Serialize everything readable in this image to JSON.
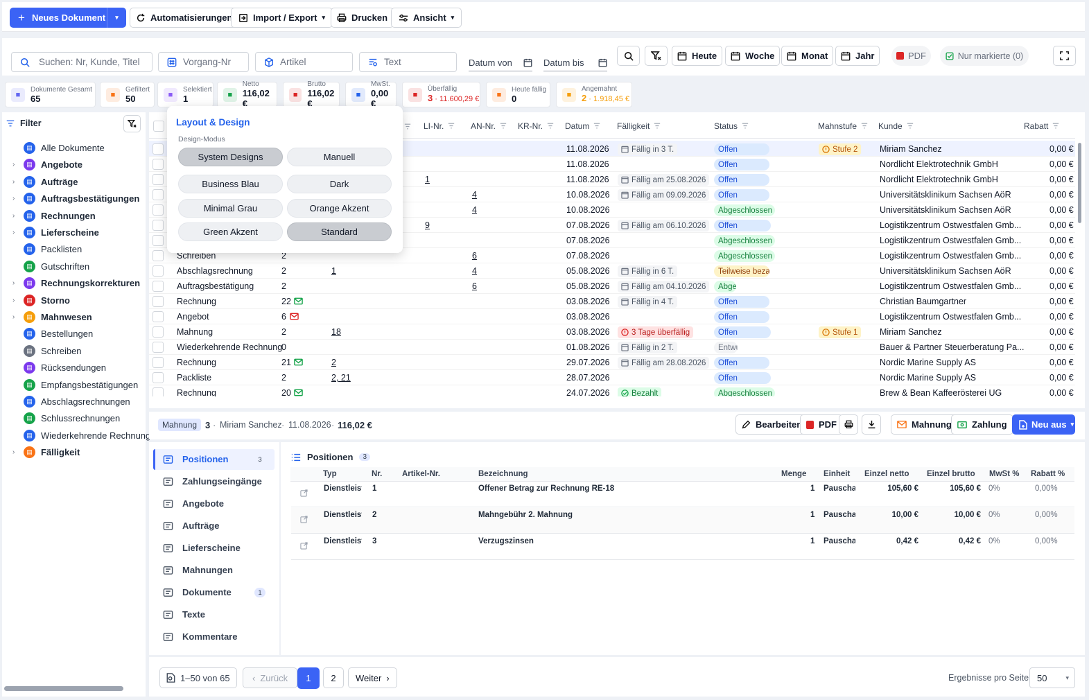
{
  "toolbar": {
    "new_doc": "Neues Dokument",
    "automations": "Automatisierungen",
    "import_export": "Import / Export",
    "print": "Drucken",
    "view": "Ansicht"
  },
  "search": {
    "search_placeholder": "Suchen: Nr, Kunde, Titel",
    "vorgang_placeholder": "Vorgang-Nr",
    "artikel_placeholder": "Artikel",
    "text_placeholder": "Text",
    "date_from": "Datum von",
    "date_to": "Datum bis",
    "today": "Heute",
    "week": "Woche",
    "month": "Monat",
    "year": "Jahr",
    "pdf": "PDF",
    "only_marked": "Nur markierte (0)"
  },
  "stats": [
    {
      "label": "Dokumente Gesamt",
      "value": "65",
      "color": "#6366f1"
    },
    {
      "label": "Gefiltert",
      "value": "50",
      "color": "#f97316"
    },
    {
      "label": "Selektiert",
      "value": "1",
      "color": "#8b5cf6"
    },
    {
      "label": "Netto",
      "value": "116,02 €",
      "color": "#16a34a"
    },
    {
      "label": "Brutto",
      "value": "116,02 €",
      "color": "#dc2626"
    },
    {
      "label": "MwSt.",
      "value": "0,00 €",
      "color": "#2563eb"
    },
    {
      "label": "Überfällig",
      "value": "3",
      "value2": "11.600,29 €",
      "color": "#dc2626"
    },
    {
      "label": "Heute fällig",
      "value": "0",
      "color": "#f97316"
    },
    {
      "label": "Angemahnt",
      "value": "2",
      "value2": "1.918,45 €",
      "color": "#f59e0b"
    }
  ],
  "sidebar": {
    "title": "Filter",
    "items": [
      {
        "label": "Alle Dokumente",
        "bold": false,
        "arrow": false,
        "color": "#2563eb"
      },
      {
        "label": "Angebote",
        "bold": true,
        "arrow": true,
        "color": "#7c3aed"
      },
      {
        "label": "Aufträge",
        "bold": true,
        "arrow": true,
        "color": "#2563eb"
      },
      {
        "label": "Auftragsbestätigungen",
        "bold": true,
        "arrow": true,
        "color": "#2563eb"
      },
      {
        "label": "Rechnungen",
        "bold": true,
        "arrow": true,
        "color": "#2563eb"
      },
      {
        "label": "Lieferscheine",
        "bold": true,
        "arrow": true,
        "color": "#2563eb"
      },
      {
        "label": "Packlisten",
        "bold": false,
        "arrow": false,
        "color": "#2563eb"
      },
      {
        "label": "Gutschriften",
        "bold": false,
        "arrow": false,
        "color": "#16a34a"
      },
      {
        "label": "Rechnungskorrekturen",
        "bold": true,
        "arrow": true,
        "color": "#7c3aed"
      },
      {
        "label": "Storno",
        "bold": true,
        "arrow": true,
        "color": "#dc2626"
      },
      {
        "label": "Mahnwesen",
        "bold": true,
        "arrow": true,
        "color": "#f59e0b"
      },
      {
        "label": "Bestellungen",
        "bold": false,
        "arrow": false,
        "color": "#2563eb"
      },
      {
        "label": "Schreiben",
        "bold": false,
        "arrow": false,
        "color": "#6b7280"
      },
      {
        "label": "Rücksendungen",
        "bold": false,
        "arrow": false,
        "color": "#7c3aed"
      },
      {
        "label": "Empfangsbestätigungen",
        "bold": false,
        "arrow": false,
        "color": "#16a34a"
      },
      {
        "label": "Abschlagsrechnungen",
        "bold": false,
        "arrow": false,
        "color": "#2563eb"
      },
      {
        "label": "Schlussrechnungen",
        "bold": false,
        "arrow": false,
        "color": "#16a34a"
      },
      {
        "label": "Wiederkehrende Rechnungen",
        "bold": false,
        "arrow": false,
        "color": "#2563eb"
      },
      {
        "label": "Fälligkeit",
        "bold": true,
        "arrow": true,
        "color": "#f97316"
      }
    ]
  },
  "table": {
    "headers": {
      "li": "LI-Nr.",
      "an": "AN-Nr.",
      "kr": "KR-Nr.",
      "datum": "Datum",
      "faellig": "Fälligkeit",
      "status": "Status",
      "mahnstufe": "Mahnstufe",
      "kunde": "Kunde",
      "rabatt": "Rabatt"
    },
    "rows": [
      {
        "typ": "",
        "nr": "",
        "ref": "",
        "li": "",
        "an": "",
        "datum": "11.08.2026",
        "due": "Fällig in 3 T.",
        "due_kind": "normal",
        "status": "Offen",
        "status_kind": "blue",
        "mahn": "Stufe 2",
        "kunde": "Miriam  Sanchez",
        "rabatt": "0,00 €",
        "mail": ""
      },
      {
        "typ": "",
        "nr": "",
        "ref": "",
        "li": "",
        "an": "",
        "datum": "11.08.2026",
        "due": "",
        "due_kind": "",
        "status": "Offen",
        "status_kind": "blue",
        "mahn": "",
        "kunde": "Nordlicht Elektrotechnik GmbH",
        "rabatt": "0,00 €",
        "mail": ""
      },
      {
        "typ": "",
        "nr": "",
        "ref": "",
        "li": "1",
        "an": "",
        "datum": "11.08.2026",
        "due": "Fällig am 25.08.2026",
        "due_kind": "normal",
        "status": "Offen",
        "status_kind": "blue",
        "mahn": "",
        "kunde": "Nordlicht Elektrotechnik GmbH",
        "rabatt": "0,00 €",
        "mail": ""
      },
      {
        "typ": "",
        "nr": "",
        "ref": "",
        "li": "",
        "an": "4",
        "datum": "10.08.2026",
        "due": "Fällig am 09.09.2026",
        "due_kind": "normal",
        "status": "Offen",
        "status_kind": "blue",
        "mahn": "",
        "kunde": "Universitätsklinikum Sachsen AöR",
        "rabatt": "0,00 €",
        "mail": ""
      },
      {
        "typ": "",
        "nr": "",
        "ref": "",
        "li": "",
        "an": "4",
        "datum": "10.08.2026",
        "due": "",
        "due_kind": "",
        "status": "Abgeschlossen",
        "status_kind": "green",
        "mahn": "",
        "kunde": "Universitätsklinikum Sachsen AöR",
        "rabatt": "0,00 €",
        "mail": ""
      },
      {
        "typ": "",
        "nr": "",
        "ref": "",
        "li": "9",
        "an": "",
        "datum": "07.08.2026",
        "due": "Fällig am 06.10.2026",
        "due_kind": "normal",
        "status": "Offen",
        "status_kind": "blue",
        "mahn": "",
        "kunde": "Logistikzentrum Ostwestfalen Gmb...",
        "rabatt": "0,00 €",
        "mail": ""
      },
      {
        "typ": "",
        "nr": "",
        "ref": "",
        "li": "",
        "an": "",
        "datum": "07.08.2026",
        "due": "",
        "due_kind": "",
        "status": "Abgeschlossen",
        "status_kind": "green",
        "mahn": "",
        "kunde": "Logistikzentrum Ostwestfalen Gmb...",
        "rabatt": "0,00 €",
        "mail": ""
      },
      {
        "typ": "Schreiben",
        "nr": "2",
        "ref": "",
        "li": "",
        "an": "6",
        "datum": "07.08.2026",
        "due": "",
        "due_kind": "",
        "status": "Abgeschlossen",
        "status_kind": "green",
        "mahn": "",
        "kunde": "Logistikzentrum Ostwestfalen Gmb...",
        "rabatt": "0,00 €",
        "mail": ""
      },
      {
        "typ": "Abschlagsrechnung",
        "nr": "2",
        "ref": "1",
        "li": "",
        "an": "4",
        "datum": "05.08.2026",
        "due": "Fällig in 6 T.",
        "due_kind": "normal",
        "status": "Teilweise bezahl",
        "status_kind": "yellow",
        "mahn": "",
        "kunde": "Universitätsklinikum Sachsen AöR",
        "rabatt": "0,00 €",
        "mail": ""
      },
      {
        "typ": "Auftragsbestätigung",
        "nr": "2",
        "ref": "",
        "li": "",
        "an": "6",
        "datum": "05.08.2026",
        "due": "Fällig am 04.10.2026",
        "due_kind": "normal",
        "status": "Abges",
        "status_kind": "green",
        "mahn": "",
        "kunde": "Logistikzentrum Ostwestfalen Gmb...",
        "rabatt": "0,00 €",
        "mail": ""
      },
      {
        "typ": "Rechnung",
        "nr": "22",
        "ref": "",
        "li": "",
        "an": "",
        "datum": "03.08.2026",
        "due": "Fällig in 4 T.",
        "due_kind": "normal",
        "status": "Offen",
        "status_kind": "blue",
        "mahn": "",
        "kunde": "Christian  Baumgartner",
        "rabatt": "0,00 €",
        "mail": "green"
      },
      {
        "typ": "Angebot",
        "nr": "6",
        "ref": "",
        "li": "",
        "an": "",
        "datum": "03.08.2026",
        "due": "",
        "due_kind": "",
        "status": "Offen",
        "status_kind": "blue",
        "mahn": "",
        "kunde": "Logistikzentrum Ostwestfalen Gmb...",
        "rabatt": "0,00 €",
        "mail": "red"
      },
      {
        "typ": "Mahnung",
        "nr": "2",
        "ref": "18",
        "li": "",
        "an": "",
        "datum": "03.08.2026",
        "due": "3 Tage überfällig",
        "due_kind": "red",
        "status": "Offen",
        "status_kind": "blue",
        "mahn": "Stufe 1",
        "kunde": "Miriam  Sanchez",
        "rabatt": "0,00 €",
        "mail": ""
      },
      {
        "typ": "Wiederkehrende Rechnung",
        "nr": "0",
        "ref": "",
        "li": "",
        "an": "",
        "datum": "01.08.2026",
        "due": "Fällig in 2 T.",
        "due_kind": "normal",
        "status": "Entwu",
        "status_kind": "gray",
        "mahn": "",
        "kunde": "Bauer & Partner Steuerberatung Pa...",
        "rabatt": "0,00 €",
        "mail": ""
      },
      {
        "typ": "Rechnung",
        "nr": "21",
        "ref": "2",
        "li": "",
        "an": "",
        "datum": "29.07.2026",
        "due": "Fällig am 28.08.2026",
        "due_kind": "normal",
        "status": "Offen",
        "status_kind": "blue",
        "mahn": "",
        "kunde": "Nordic Marine Supply AS",
        "rabatt": "0,00 €",
        "mail": "green"
      },
      {
        "typ": "Packliste",
        "nr": "2",
        "ref": "2, 21",
        "li": "",
        "an": "",
        "datum": "28.07.2026",
        "due": "",
        "due_kind": "",
        "status": "Offen",
        "status_kind": "blue",
        "mahn": "",
        "kunde": "Nordic Marine Supply AS",
        "rabatt": "0,00 €",
        "mail": ""
      },
      {
        "typ": "Rechnung",
        "nr": "20",
        "ref": "",
        "li": "",
        "an": "",
        "datum": "24.07.2026",
        "due": "Bezahlt",
        "due_kind": "ok",
        "status": "Abgeschlossen",
        "status_kind": "green",
        "mahn": "",
        "kunde": "Brew & Bean Kaffeerösterei UG",
        "rabatt": "0,00 €",
        "mail": "green"
      }
    ]
  },
  "popup": {
    "title": "Layout & Design",
    "subtitle": "Design-Modus",
    "options": [
      "System Designs",
      "Manuell",
      "Business Blau",
      "Dark",
      "Minimal Grau",
      "Orange Akzent",
      "Green Akzent",
      "Standard"
    ]
  },
  "detail": {
    "type_badge": "Mahnung",
    "number": "3",
    "customer": "Miriam Sanchez",
    "date": "11.08.2026",
    "amount": "116,02 €",
    "edit": "Bearbeiten",
    "pdf": "PDF",
    "mahnung": "Mahnung",
    "zahlung": "Zahlung",
    "neu_aus": "Neu aus",
    "nav": [
      {
        "label": "Positionen",
        "count": "3"
      },
      {
        "label": "Zahlungseingänge",
        "count": ""
      },
      {
        "label": "Angebote",
        "count": ""
      },
      {
        "label": "Aufträge",
        "count": ""
      },
      {
        "label": "Lieferscheine",
        "count": ""
      },
      {
        "label": "Mahnungen",
        "count": ""
      },
      {
        "label": "Dokumente",
        "count": "1"
      },
      {
        "label": "Texte",
        "count": ""
      },
      {
        "label": "Kommentare",
        "count": ""
      }
    ],
    "positions_title": "Positionen",
    "positions_count": "3",
    "pos_headers": {
      "typ": "Typ",
      "nr": "Nr.",
      "artikel": "Artikel-Nr.",
      "bez": "Bezeichnung",
      "menge": "Menge",
      "einheit": "Einheit",
      "netto": "Einzel netto",
      "brutto": "Einzel brutto",
      "mwst": "MwSt %",
      "rabatt": "Rabatt %"
    },
    "positions": [
      {
        "typ": "Dienstleist",
        "nr": "1",
        "bez": "Offener Betrag zur Rechnung RE-18",
        "menge": "1",
        "einheit": "Pauschal",
        "netto": "105,60 €",
        "brutto": "105,60 €",
        "mwst": "0%",
        "rabatt": "0,00%"
      },
      {
        "typ": "Dienstleist",
        "nr": "2",
        "bez": "Mahngebühr 2. Mahnung",
        "menge": "1",
        "einheit": "Pauschal",
        "netto": "10,00 €",
        "brutto": "10,00 €",
        "mwst": "0%",
        "rabatt": "0,00%"
      },
      {
        "typ": "Dienstleist",
        "nr": "3",
        "bez": "Verzugszinsen",
        "menge": "1",
        "einheit": "Pauschal",
        "netto": "0,42 €",
        "brutto": "0,42 €",
        "mwst": "0%",
        "rabatt": "0,00%"
      }
    ]
  },
  "footer": {
    "range": "1–50 von 65",
    "back": "Zurück",
    "page1": "1",
    "page2": "2",
    "next": "Weiter",
    "per_page_label": "Ergebnisse pro Seite",
    "per_page": "50"
  }
}
